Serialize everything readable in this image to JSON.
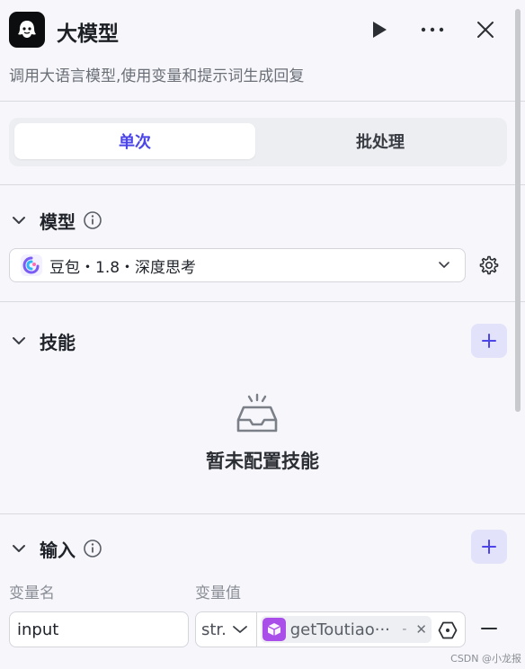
{
  "header": {
    "title": "大模型",
    "subtitle": "调用大语言模型,使用变量和提示词生成回复"
  },
  "mode_tabs": [
    {
      "label": "单次",
      "active": true
    },
    {
      "label": "批处理",
      "active": false
    }
  ],
  "model_section": {
    "title": "模型",
    "selected_model": "豆包・1.8・深度思考"
  },
  "skills_section": {
    "title": "技能",
    "empty_text": "暂未配置技能"
  },
  "input_section": {
    "title": "输入",
    "col_name": "变量名",
    "col_value": "变量值",
    "rows": [
      {
        "name": "input",
        "type": "str.",
        "ref": "getToutiao···",
        "ref_suffix": "-"
      }
    ]
  },
  "watermark": "CSDN @小龙报",
  "colors": {
    "accent": "#4c46e8",
    "add_button_bg": "#e3e2fb",
    "ref_tag_icon": "#a94ee8"
  },
  "icons": [
    "bot-logo-icon",
    "play-icon",
    "more-icon",
    "close-icon",
    "chevron-down-icon",
    "info-icon",
    "model-logo-icon",
    "gear-icon",
    "plus-icon",
    "empty-box-icon",
    "ref-node-icon",
    "variable-ref-icon",
    "minus-icon"
  ]
}
